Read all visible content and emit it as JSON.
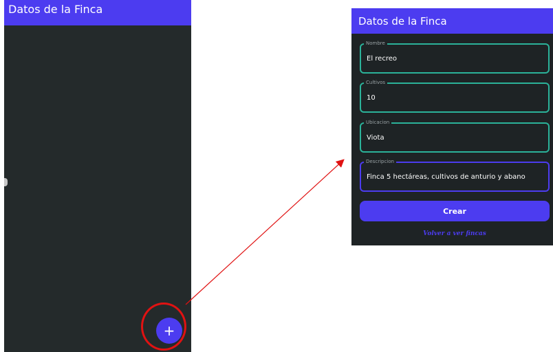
{
  "left_screen": {
    "appbar_title": "Datos de la Finca",
    "fab_label": "+"
  },
  "right_screen": {
    "appbar_title": "Datos de la Finca",
    "fields": [
      {
        "label": "Nombre",
        "value": "El recreo"
      },
      {
        "label": "Cultivos",
        "value": "10"
      },
      {
        "label": "Ubicacion",
        "value": "Viota"
      },
      {
        "label": "Descripcion",
        "value": "Finca 5 hectáreas, cultivos de anturio y abano"
      }
    ],
    "submit_label": "Crear",
    "back_link": "Volver a ver fincas"
  },
  "colors": {
    "accent": "#4c3cf0",
    "background": "#242a2b",
    "field_border": "#2bb39a",
    "annotation": "#e01212"
  }
}
